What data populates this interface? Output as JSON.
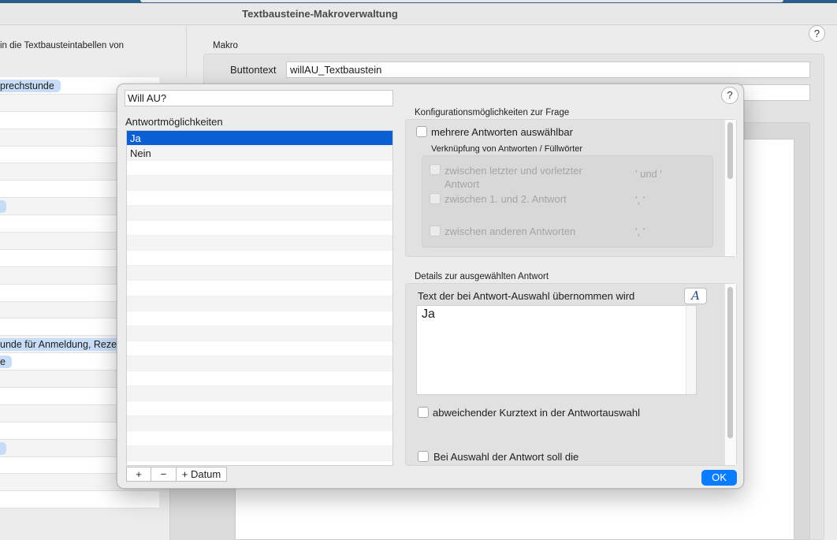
{
  "window": {
    "title": "Textbausteine-Makroverwaltung"
  },
  "left_pane": {
    "intro_text": "in die Textbausteintabellen von",
    "rows": [
      {
        "pill": "prechstunde"
      },
      {
        "pill": ""
      },
      {
        "pill": ""
      },
      {
        "pill": ""
      },
      {
        "pill": ""
      },
      {
        "pill": ""
      },
      {
        "pill": ""
      },
      {
        "pill": ""
      },
      {
        "pill": ""
      },
      {
        "pill": ""
      },
      {
        "pill": ""
      },
      {
        "pill": ""
      },
      {
        "pill": ""
      },
      {
        "pill": ""
      },
      {
        "pill": ""
      },
      {
        "pill": "unde für Anmeldung, Reze"
      },
      {
        "pill": "e"
      },
      {
        "pill": ""
      },
      {
        "pill": ""
      },
      {
        "pill": ""
      },
      {
        "pill": ""
      },
      {
        "pill": ""
      },
      {
        "pill": ""
      },
      {
        "pill": ""
      },
      {
        "pill": ""
      }
    ]
  },
  "right_pane": {
    "makro_label": "Makro",
    "buttontext_label": "Buttontext",
    "buttontext_value": "willAU_Textbaustein",
    "help_label": "?"
  },
  "dialog": {
    "question_value": "Will AU?",
    "help_label": "?",
    "answers_label": "Antwortmöglichkeiten",
    "answers": [
      "Ja",
      "Nein"
    ],
    "selected_answer": "Ja",
    "list_buttons": {
      "add": "+",
      "remove": "−",
      "add_date": "+ Datum"
    },
    "config": {
      "section_label": "Konfigurationsmöglichkeiten zur Frage",
      "multi_answer_label": "mehrere Antworten auswählbar",
      "linking_label": "Verknüpfung von Antworten / Füllwörter",
      "link_last_label": "zwischen letzter und vorletzter Antwort",
      "link_last_value": "' und '",
      "link_first_label": "zwischen 1. und 2. Antwort",
      "link_first_value": "', '",
      "link_other_label": "zwischen anderen Antworten",
      "link_other_value": "', '"
    },
    "details": {
      "section_label": "Details zur ausgewählten Antwort",
      "text_label": "Text der bei Antwort-Auswahl übernommen wird",
      "text_value": "Ja",
      "font_button": "A",
      "short_text_label": "abweichender Kurztext in der Antwortauswahl",
      "on_select_label": "Bei Auswahl der Antwort soll die"
    },
    "ok_label": "OK"
  }
}
